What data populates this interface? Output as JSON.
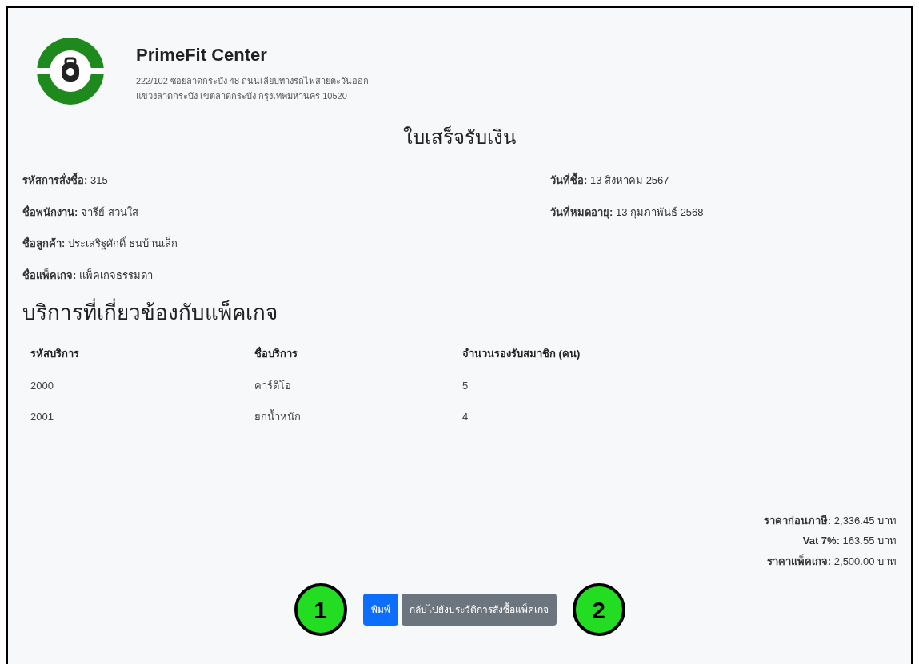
{
  "company": {
    "name": "PrimeFit Center",
    "address_lines": [
      "222/102 ซอยลาดกระบัง 48 ถนนเลียบทางรถไฟสายตะวันออก",
      "แขวงลาดกระบัง เขตลาดกระบัง กรุงเทพมหานคร 10520"
    ]
  },
  "title": "ใบเสร็จรับเงิน",
  "details_left": [
    {
      "label": "รหัสการสั่งซื้อ:",
      "value": "315"
    },
    {
      "label": "ชื่อพนักงาน:",
      "value": "จารีย์ สวนใส"
    },
    {
      "label": "ชื่อลูกค้า:",
      "value": "ประเสริฐศักดิ์ ธนบ้านเล็ก"
    },
    {
      "label": "ชื่อแพ็คเกจ:",
      "value": "แพ็คเกจธรรมดา"
    }
  ],
  "details_right": [
    {
      "label": "วันที่ซื้อ:",
      "value": "13 สิงหาคม 2567"
    },
    {
      "label": "วันที่หมดอายุ:",
      "value": "13 กุมภาพันธ์ 2568"
    }
  ],
  "services_heading": "บริการที่เกี่ยวข้องกับแพ็คเกจ",
  "table": {
    "columns": [
      "รหัสบริการ",
      "ชื่อบริการ",
      "จำนวนรองรับสมาชิก (คน)"
    ],
    "rows": [
      [
        "2000",
        "คาร์ดิโอ",
        "5"
      ],
      [
        "2001",
        "ยกน้ำหนัก",
        "4"
      ]
    ]
  },
  "totals": [
    {
      "label": "ราคาก่อนภาษี:",
      "value": "2,336.45 บาท"
    },
    {
      "label": "Vat 7%:",
      "value": "163.55 บาท"
    },
    {
      "label": "ราคาแพ็คเกจ:",
      "value": "2,500.00 บาท"
    }
  ],
  "buttons": [
    {
      "label": "พิมพ์",
      "kind": "primary"
    },
    {
      "label": "กลับไปยังประวัติการสั่งซื้อแพ็คเกจ",
      "kind": "secondary"
    }
  ],
  "callouts": [
    "1",
    "2"
  ]
}
